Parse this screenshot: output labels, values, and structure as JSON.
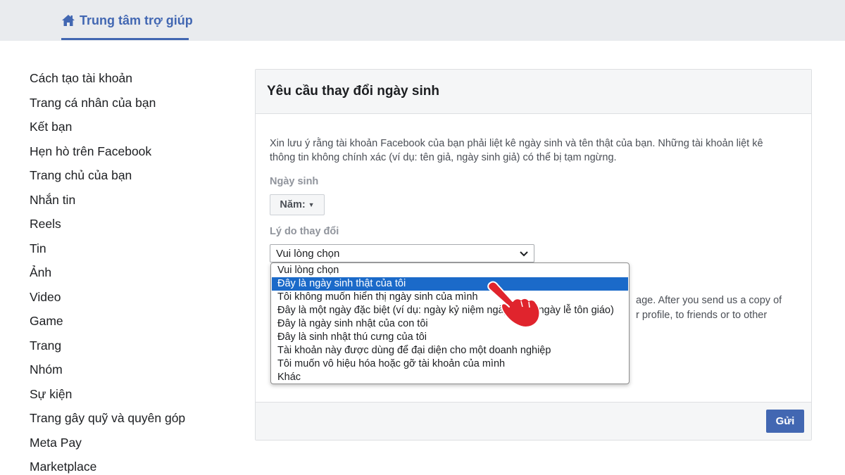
{
  "header": {
    "help_center_label": "Trung tâm trợ giúp",
    "help_icon": "home-icon",
    "brand_color": "#4267b2"
  },
  "sidebar": {
    "items": [
      {
        "label": "Cách tạo tài khoản"
      },
      {
        "label": "Trang cá nhân của bạn"
      },
      {
        "label": "Kết bạn"
      },
      {
        "label": "Hẹn hò trên Facebook"
      },
      {
        "label": "Trang chủ của bạn"
      },
      {
        "label": "Nhắn tin"
      },
      {
        "label": "Reels"
      },
      {
        "label": "Tin"
      },
      {
        "label": "Ảnh"
      },
      {
        "label": "Video"
      },
      {
        "label": "Game"
      },
      {
        "label": "Trang"
      },
      {
        "label": "Nhóm"
      },
      {
        "label": "Sự kiện"
      },
      {
        "label": "Trang gây quỹ và quyên góp"
      },
      {
        "label": "Meta Pay"
      },
      {
        "label": "Marketplace"
      }
    ]
  },
  "form": {
    "title": "Yêu cầu thay đổi ngày sinh",
    "notice": "Xin lưu ý rằng tài khoản Facebook của bạn phải liệt kê ngày sinh và tên thật của bạn. Những tài khoản liệt kê thông tin không chính xác (ví dụ: tên giả, ngày sinh giả) có thể bị tạm ngừng.",
    "birthday_label": "Ngày sinh",
    "year_button": "Năm:",
    "reason_label": "Lý do thay đổi",
    "reason_select_value": "Vui lòng chọn",
    "info_text_line1": "age. After you send us a copy of",
    "info_text_line2": "r profile, to friends or to other",
    "send_label": "Gửi"
  },
  "dropdown": {
    "selected_index": 1,
    "options": [
      {
        "label": "Vui lòng chọn"
      },
      {
        "label": "Đây là ngày sinh thật của tôi"
      },
      {
        "label": "Tôi không muốn hiển thị ngày sinh của mình"
      },
      {
        "label": "Đây là một ngày đặc biệt (ví dụ: ngày kỷ niệm ngày cưới, ngày lễ tôn giáo)"
      },
      {
        "label": "Đây là ngày sinh nhật của con tôi"
      },
      {
        "label": "Đây là sinh nhật thú cưng của tôi"
      },
      {
        "label": "Tài khoản này được dùng để đại diện cho một doanh nghiệp"
      },
      {
        "label": "Tôi muốn vô hiệu hóa hoặc gỡ tài khoản của mình"
      },
      {
        "label": "Khác"
      }
    ],
    "highlight_color": "#1b6ac9"
  },
  "overlay": {
    "cursor_icon": "pointing-hand-icon",
    "cursor_color": "#e0242d"
  }
}
